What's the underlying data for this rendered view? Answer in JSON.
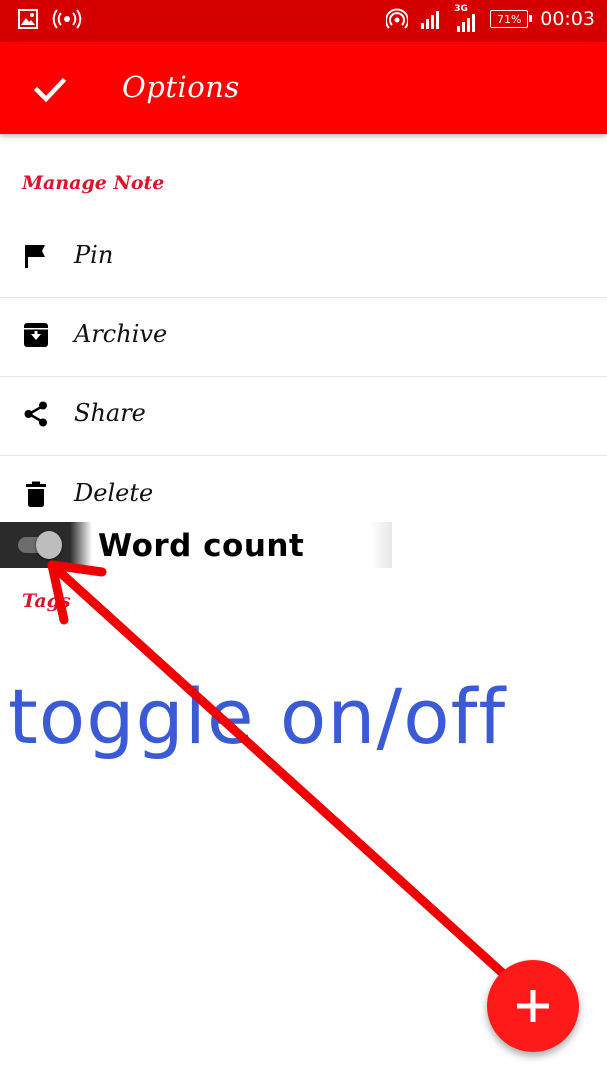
{
  "status_bar": {
    "battery": "71%",
    "network": "3G",
    "time": "00:03"
  },
  "app_bar": {
    "title": "Options",
    "confirm_icon": "check-icon"
  },
  "manage_note": {
    "header": "Manage Note",
    "items": [
      {
        "label": "Pin",
        "icon": "flag-icon"
      },
      {
        "label": "Archive",
        "icon": "archive-icon"
      },
      {
        "label": "Share",
        "icon": "share-icon"
      },
      {
        "label": "Delete",
        "icon": "trash-icon"
      }
    ]
  },
  "word_count": {
    "label": "Word count",
    "toggle_state": "on"
  },
  "tags": {
    "header": "Tags"
  },
  "annotation": {
    "text": "toggle on/off",
    "color": "#3b5bd6",
    "arrow_color": "#f00000"
  },
  "fab": {
    "icon": "plus-icon"
  },
  "colors": {
    "status_bar": "#d50000",
    "app_bar": "#ff0000",
    "accent": "#e0112b",
    "fab": "#ff1a1a"
  }
}
